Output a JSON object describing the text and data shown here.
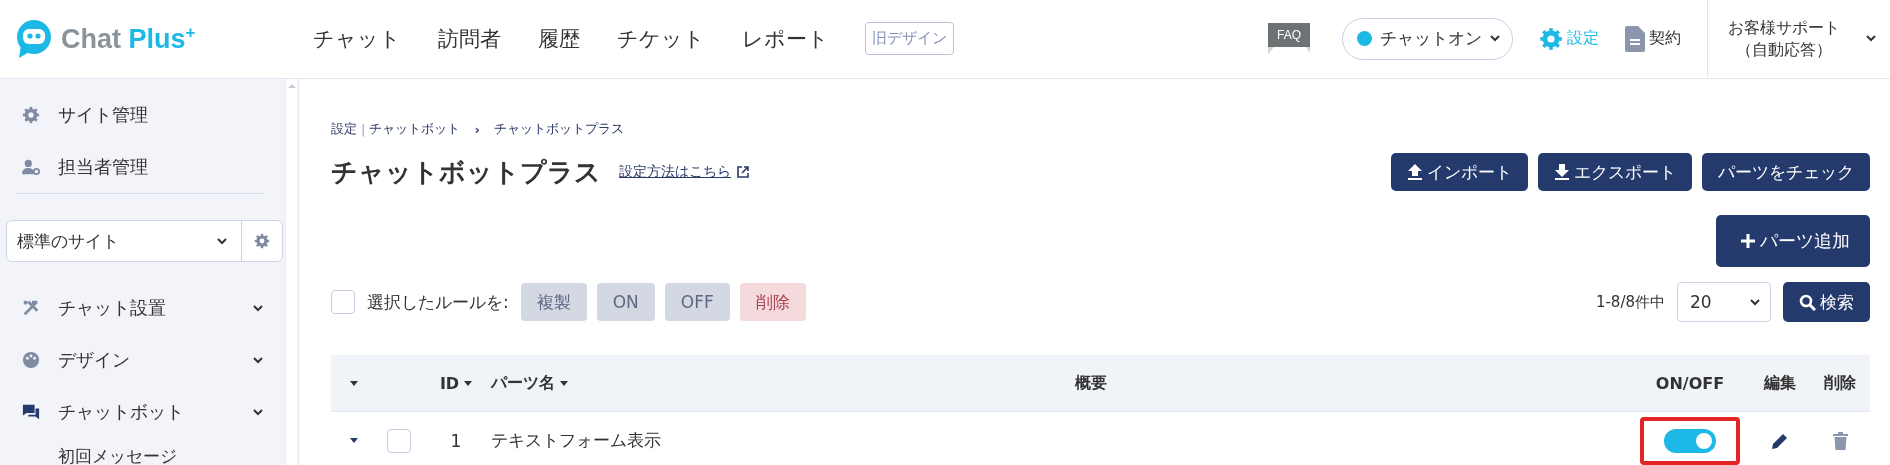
{
  "header": {
    "logo": {
      "words": [
        "Chat",
        "Plus"
      ],
      "sup": "+"
    },
    "nav": [
      {
        "label": "チャット"
      },
      {
        "label": "訪問者"
      },
      {
        "label": "履歴"
      },
      {
        "label": "チケット"
      },
      {
        "label": "レポート"
      }
    ],
    "old_design": "旧デザイン",
    "faq": "FAQ",
    "status": {
      "label": "チャットオン",
      "on": true
    },
    "settings": {
      "label": "設定",
      "selected": true
    },
    "contract": {
      "label": "契約",
      "selected": false
    },
    "support": [
      "お客様サポート",
      "（自動応答）"
    ]
  },
  "sidebar": {
    "top_items": [
      {
        "label": "サイト管理"
      },
      {
        "label": "担当者管理"
      }
    ],
    "site_select": {
      "value": "標準のサイト"
    },
    "menu": [
      {
        "label": "チャット設置"
      },
      {
        "label": "デザイン"
      },
      {
        "label": "チャットボット",
        "children": [
          {
            "label": "初回メッセージ"
          }
        ]
      }
    ]
  },
  "breadcrumb": {
    "items": [
      "設定",
      "チャットボット",
      "チャットボットプラス"
    ],
    "separators": [
      "|",
      "›"
    ]
  },
  "title": "チャットボットプラス",
  "help_link": "設定方法はこちら",
  "actions": [
    {
      "label": "インポート"
    },
    {
      "label": "エクスポート"
    },
    {
      "label": "パーツをチェック"
    }
  ],
  "add_button": {
    "label": "パーツ追加"
  },
  "bulk": {
    "checked": false,
    "label": "選択したルールを:",
    "buttons": [
      {
        "label": "複製",
        "kind": "neutral",
        "disabled": true
      },
      {
        "label": "ON",
        "kind": "neutral",
        "disabled": true
      },
      {
        "label": "OFF",
        "kind": "neutral",
        "disabled": true
      },
      {
        "label": "削除",
        "kind": "danger",
        "disabled": true
      }
    ]
  },
  "pager": {
    "count": "1-8/8件中",
    "per_page": "20",
    "search": "検索"
  },
  "table": {
    "columns": [
      {
        "label": "ID",
        "sortable": true
      },
      {
        "label": "パーツ名",
        "sortable": true
      },
      {
        "label": "概要",
        "sortable": false
      },
      {
        "label": "ON/OFF",
        "sortable": false
      },
      {
        "label": "編集",
        "sortable": false
      },
      {
        "label": "削除",
        "sortable": false
      }
    ],
    "rows": [
      {
        "id": "1",
        "name": "テキストフォーム表示",
        "checked": false,
        "on": true,
        "highlighted": true
      }
    ]
  }
}
